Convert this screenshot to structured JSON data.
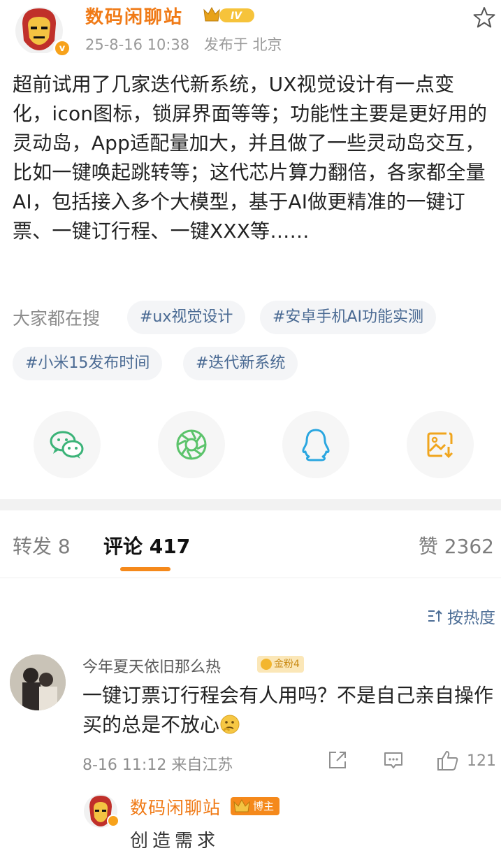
{
  "post": {
    "author": "数码闲聊站",
    "level_badge": "IV",
    "verified_badge": "v",
    "date": "25-8-16 10:38",
    "location": "发布于 北京",
    "text": "超前试用了几家迭代新系统，UX视觉设计有一点变化，icon图标，锁屏界面等等；功能性主要是更好用的灵动岛，App适配量加大，并且做了一些灵动岛交互，比如一键唤起跳转等；这代芯片算力翻倍，各家都全量AI，包括接入多个大模型，基于AI做更精准的一键订票、一键订行程、一键XXX等……"
  },
  "search": {
    "label": "大家都在搜",
    "tags": [
      "#ux视觉设计",
      "#安卓手机AI功能实测",
      "#小米15发布时间",
      "#迭代新系统"
    ]
  },
  "share": {
    "icons": [
      "wechat-icon",
      "moments-icon",
      "qq-icon",
      "save-image-icon"
    ]
  },
  "tabs": {
    "repost": "转发 8",
    "comment": "评论 417",
    "like": "赞 2362"
  },
  "sort": {
    "label": "按热度"
  },
  "comment": {
    "user": "今年夏天依旧那么热",
    "badge": "金粉4",
    "text": "一键订票订行程会有人用吗？不是自己亲自操作买的总是不放心",
    "time": "8-16 11:12",
    "location": "来自江苏",
    "likes": "121"
  },
  "reply": {
    "user": "数码闲聊站",
    "badge": "博主",
    "text": "创造需求"
  },
  "colors": {
    "author": "#f07a16",
    "accent": "#f5891b",
    "link": "#4a6a93",
    "wechat": "#3bb378",
    "moments": "#5cc36b",
    "qq": "#2aa6e0",
    "save": "#f0a51e"
  }
}
